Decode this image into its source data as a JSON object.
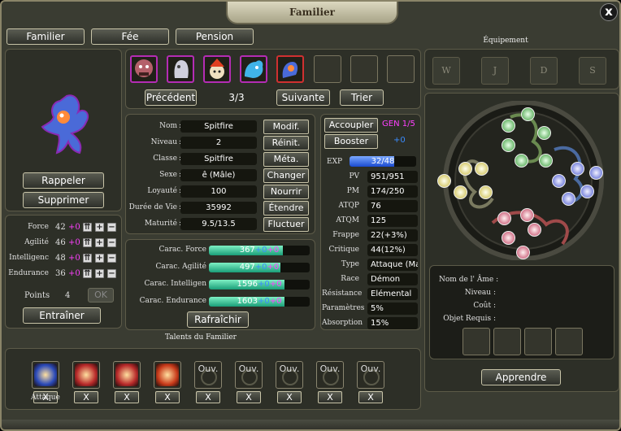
{
  "window": {
    "title": "Familier",
    "close": "x"
  },
  "tabs": [
    "Familier",
    "Fée",
    "Pension"
  ],
  "pets": {
    "prev": "Précédent",
    "page": "3/3",
    "next": "Suivante",
    "sort": "Trier"
  },
  "left": {
    "recall": "Rappeler",
    "delete": "Supprimer",
    "train": "Entraîner",
    "ok": "OK"
  },
  "stats": [
    {
      "label": "Force",
      "value": "42",
      "bonus": "+0"
    },
    {
      "label": "Agilité",
      "value": "46",
      "bonus": "+0"
    },
    {
      "label": "Intelligenc",
      "value": "48",
      "bonus": "+0"
    },
    {
      "label": "Endurance",
      "value": "36",
      "bonus": "+0"
    }
  ],
  "points": {
    "label": "Points",
    "value": "4"
  },
  "info": [
    {
      "label": "Nom",
      "value": "Spitfire",
      "button": "Modif."
    },
    {
      "label": "Niveau",
      "value": "2",
      "button": "Réinit."
    },
    {
      "label": "Classe",
      "value": "Spitfire",
      "button": "Méta."
    },
    {
      "label": "Sexe",
      "value": "ê (Mâle)",
      "button": "Changer"
    },
    {
      "label": "Loyauté",
      "value": "100",
      "button": "Nourrir"
    },
    {
      "label": "Durée de Vie",
      "value": "35992",
      "button": "Étendre"
    },
    {
      "label": "Maturité",
      "value": "9.5/13.5",
      "button": "Fluctuer"
    }
  ],
  "carac": [
    {
      "label": "Carac. Force",
      "value": "367",
      "b1": "+0",
      "b2": "+0",
      "fill": 0.73
    },
    {
      "label": "Carac. Agilité",
      "value": "497",
      "b1": "+0",
      "b2": "+0",
      "fill": 0.71
    },
    {
      "label": "Carac. Intelligen",
      "value": "1596",
      "b1": "+0",
      "b2": "+0",
      "fill": 0.75
    },
    {
      "label": "Carac. Endurance",
      "value": "1603",
      "b1": "+0",
      "b2": "+0",
      "fill": 0.75
    }
  ],
  "refresh": "Rafraîchir",
  "actions": {
    "couple": "Accoupler",
    "gen": "GEN 1/5",
    "boost": "Booster",
    "boost_val": "+0"
  },
  "exp": {
    "label": "EXP",
    "value": "32/48",
    "fill": 0.67
  },
  "combat": [
    {
      "label": "PV",
      "value": "951/951"
    },
    {
      "label": "PM",
      "value": "174/250"
    },
    {
      "label": "ATQP",
      "value": "76"
    },
    {
      "label": "ATQM",
      "value": "125"
    },
    {
      "label": "Frappe",
      "value": "22(+3%)"
    },
    {
      "label": "Critique",
      "value": "44(12%)"
    },
    {
      "label": "Type",
      "value": "Attaque (Ma"
    },
    {
      "label": "Race",
      "value": "Démon"
    },
    {
      "label": "Résistance",
      "value": "Elémental"
    },
    {
      "label": "Paramètres",
      "value": "5%"
    },
    {
      "label": "Absorption",
      "value": "15%"
    }
  ],
  "equip": {
    "title": "Équipement",
    "slots": [
      "W",
      "J",
      "D",
      "S"
    ]
  },
  "soul": {
    "name": "Nom de l' Âme",
    "level": "Niveau",
    "cost": "Coût",
    "req": "Objet Requis",
    "learn": "Apprendre"
  },
  "talents": {
    "title": "Talents du Familier",
    "first_label": "Attaque",
    "open": "Ouv.",
    "x": "X"
  },
  "colors": {
    "accent_blue": "#3a8cff",
    "magenta": "#ff40ff",
    "pet_border": "#b42cb4",
    "bar_fill": "#1a9e78"
  }
}
